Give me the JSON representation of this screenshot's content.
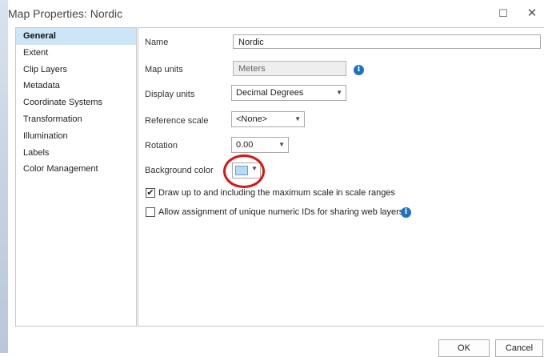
{
  "window": {
    "title": "Map Properties: Nordic",
    "maximize_glyph": "☐",
    "close_glyph": "✕"
  },
  "sidebar": {
    "items": [
      {
        "label": "General",
        "selected": true
      },
      {
        "label": "Extent"
      },
      {
        "label": "Clip Layers"
      },
      {
        "label": "Metadata"
      },
      {
        "label": "Coordinate Systems"
      },
      {
        "label": "Transformation"
      },
      {
        "label": "Illumination"
      },
      {
        "label": "Labels"
      },
      {
        "label": "Color Management"
      }
    ]
  },
  "general": {
    "name": {
      "label": "Name",
      "value": "Nordic"
    },
    "map_units": {
      "label": "Map units",
      "value": "Meters",
      "info_icon": "info-icon"
    },
    "display_units": {
      "label": "Display units",
      "value": "Decimal Degrees"
    },
    "reference_scale": {
      "label": "Reference scale",
      "value": "<None>"
    },
    "rotation": {
      "label": "Rotation",
      "value": "0.00"
    },
    "background_color": {
      "label": "Background color",
      "color": "#b3dcf6"
    },
    "draw_max_scale": {
      "label": "Draw up to and including the maximum scale in scale ranges",
      "checked": true
    },
    "unique_ids": {
      "label": "Allow assignment of unique numeric IDs for sharing web layers",
      "checked": false
    }
  },
  "footer": {
    "ok_label": "OK",
    "cancel_label": "Cancel"
  },
  "colors": {
    "selection": "#cde6f7",
    "highlight_circle": "#e01010",
    "info_icon": "#1b73c8"
  }
}
